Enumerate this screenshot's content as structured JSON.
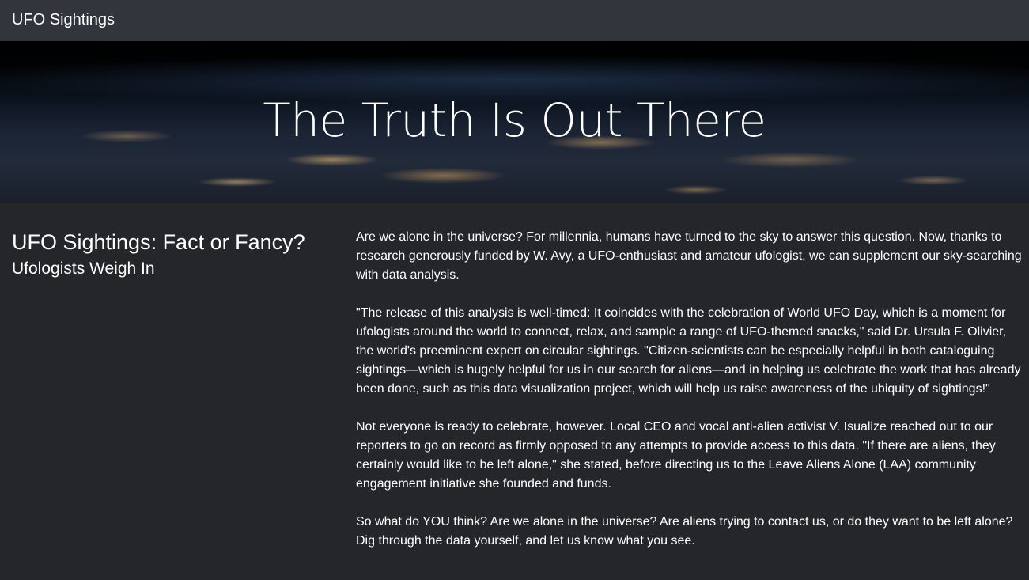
{
  "navbar": {
    "brand": "UFO Sightings"
  },
  "hero": {
    "title": "The Truth Is Out There"
  },
  "article": {
    "heading": "UFO Sightings: Fact or Fancy?",
    "subheading": "Ufologists Weigh In",
    "paragraphs": [
      "Are we alone in the universe? For millennia, humans have turned to the sky to answer this question. Now, thanks to research generously funded by W. Avy, a UFO-enthusiast and amateur ufologist, we can supplement our sky-searching with data analysis.",
      "\"The release of this analysis is well-timed: It coincides with the celebration of World UFO Day, which is a moment for ufologists around the world to connect, relax, and sample a range of UFO-themed snacks,\" said Dr. Ursula F. Olivier, the world's preeminent expert on circular sightings. \"Citizen-scientists can be especially helpful in both cataloguing sightings—which is hugely helpful for us in our search for aliens—and in helping us celebrate the work that has already been done, such as this data visualization project, which will help us raise awareness of the ubiquity of sightings!\"",
      "Not everyone is ready to celebrate, however. Local CEO and vocal anti-alien activist V. Isualize reached out to our reporters to go on record as firmly opposed to any attempts to provide access to this data. \"If there are aliens, they certainly would like to be left alone,\" she stated, before directing us to the Leave Aliens Alone (LAA) community engagement initiative she founded and funds.",
      "So what do YOU think? Are we alone in the universe? Are aliens trying to contact us, or do they want to be left alone? Dig through the data yourself, and let us know what you see."
    ]
  },
  "colors": {
    "navbar_bg": "#32353b",
    "page_bg": "#242629",
    "text": "#ffffff"
  }
}
